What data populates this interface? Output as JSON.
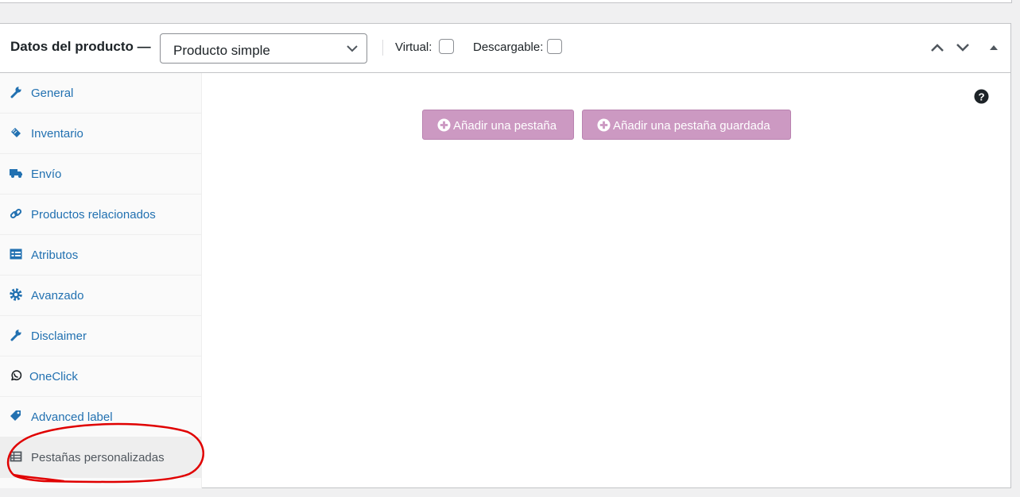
{
  "header": {
    "title": "Datos del producto —",
    "product_type": "Producto simple",
    "virtual_label": "Virtual:",
    "downloadable_label": "Descargable:"
  },
  "sidebar": {
    "items": [
      {
        "label": "General",
        "icon": "wrench-icon"
      },
      {
        "label": "Inventario",
        "icon": "tag-icon"
      },
      {
        "label": "Envío",
        "icon": "truck-icon"
      },
      {
        "label": "Productos relacionados",
        "icon": "link-icon"
      },
      {
        "label": "Atributos",
        "icon": "list-icon"
      },
      {
        "label": "Avanzado",
        "icon": "gear-icon"
      },
      {
        "label": "Disclaimer",
        "icon": "wrench-icon"
      },
      {
        "label": "OneClick",
        "icon": "whatsapp-icon"
      },
      {
        "label": "Advanced label",
        "icon": "tag-icon"
      },
      {
        "label": "Pestañas personalizadas",
        "icon": "table-icon",
        "active": true
      }
    ]
  },
  "main": {
    "add_tab_label": "Añadir una pestaña",
    "add_saved_tab_label": "Añadir una pestaña guardada"
  },
  "colors": {
    "link": "#2271b1",
    "button_bg": "#cc99c2",
    "annotation": "#e00000"
  }
}
